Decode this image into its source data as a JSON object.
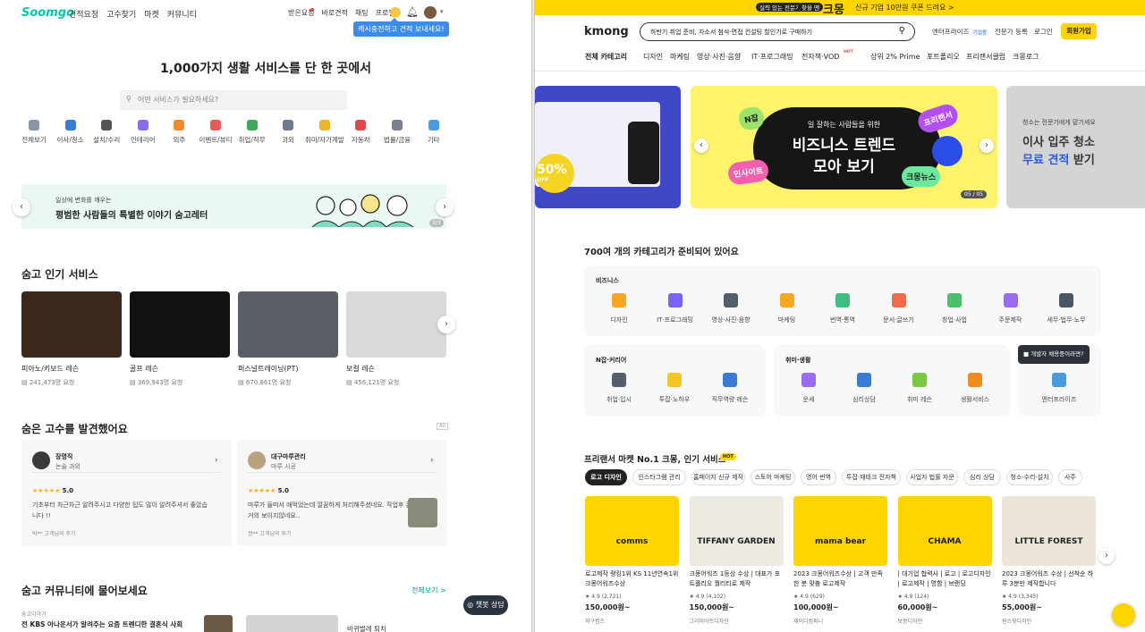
{
  "left": {
    "logo": "Soomgo",
    "nav": [
      "견적요청",
      "고수찾기",
      "마켓",
      "커뮤니티"
    ],
    "right_nav": [
      "받은요청",
      "바로견적",
      "채팅",
      "프로필"
    ],
    "tooltip": "캐시충전하고 견적 보내세요!",
    "hero": "1,000가지 생활 서비스를 단 한 곳에서",
    "search_placeholder": "어떤 서비스가 필요하세요?",
    "categories": [
      {
        "label": "전체보기",
        "color": "#8a95a5"
      },
      {
        "label": "이사/청소",
        "color": "#3a7bd5"
      },
      {
        "label": "설치/수리",
        "color": "#555"
      },
      {
        "label": "인테리어",
        "color": "#8e6be8"
      },
      {
        "label": "외주",
        "color": "#f08c2e"
      },
      {
        "label": "이벤트/뷰티",
        "color": "#e85a5a"
      },
      {
        "label": "취업/직무",
        "color": "#3aaa5a"
      },
      {
        "label": "과외",
        "color": "#6b7a8c"
      },
      {
        "label": "취미/자기계발",
        "color": "#f0b429"
      },
      {
        "label": "자동차",
        "color": "#e04848"
      },
      {
        "label": "법률/금융",
        "color": "#7a8090"
      },
      {
        "label": "기타",
        "color": "#4a9be0"
      }
    ],
    "banner": {
      "small": "일상에 변화를 깨우는",
      "big": "평범한 사람들의 특별한 이야기 숨고레터",
      "page": "3/3"
    },
    "popular_title": "숨고 인기 서비스",
    "services": [
      {
        "name": "피아노/키보드 레슨",
        "count": "241,473명 요청",
        "color": "#3a2a1e"
      },
      {
        "name": "골프 레슨",
        "count": "369,943명 요청",
        "color": "#111"
      },
      {
        "name": "퍼스널트레이닝(PT)",
        "count": "670,861명 요청",
        "color": "#5a5f66"
      },
      {
        "name": "보컬 레슨",
        "count": "456,121명 요청",
        "color": "#d9d9d9"
      }
    ],
    "pros_title": "숨은 고수를 발견했어요",
    "ad": "AD",
    "pros": [
      {
        "name": "장명직",
        "sub": "논술 과외",
        "rating": "5.0",
        "review": "기초부터 차근차근 알려주시고 다양한 팁도 많이 알려주셔서 좋았습니다 !!",
        "by": "박** 고객님의 후기",
        "avatar": "#3a3a3a"
      },
      {
        "name": "대구마루관리",
        "sub": "마루 시공",
        "rating": "5.0",
        "review": "마루가 들떠서 애먹었는데 깔끔하게 처리해주셨네요. 작업후 흔적이 거의 보이지않네요..",
        "by": "권** 고객님의 후기",
        "avatar": "#b9a27c"
      }
    ],
    "community_title": "숨고 커뮤니티에 물어보세요",
    "view_all": "전체보기 >",
    "community_tag": "숨고이야기",
    "community_item": "전 KBS 아나운서가 알려주는 요즘 트렌디한 결혼식 사회",
    "community_item2": "바뀌벌레 퇴치",
    "chatbot": "챗봇 상담"
  },
  "right": {
    "topbar": {
      "a": "실력 있는 전문가",
      "b": "찾을 땐",
      "c": "크몽",
      "d": "신규 기업 10만원 쿠폰 드려요 >"
    },
    "logo": "kmong",
    "search_value": "하반기 취업 준비, 자소서 첨삭·면접 컨설팅 할인기로 구매하기",
    "top_links": [
      "엔터프라이즈",
      "전문가 등록",
      "로그인"
    ],
    "enterprise_badge": "기업용",
    "join": "회원가입",
    "menu": [
      "전체 카테고리",
      "디자인",
      "마케팅",
      "영상·사진·음향",
      "IT·프로그래밍",
      "전자책·VOD",
      "상위 2% Prime",
      "포트폴리오",
      "프리랜서클럽",
      "크몽로그"
    ],
    "hot": "HOT",
    "slides": {
      "left_badge": "50%",
      "left_off": "OFF",
      "center": {
        "line1": "일 잘하는 사람들을 위한",
        "line2": "비즈니스 트렌드",
        "line3": "모아 보기",
        "tags": [
          "N잡",
          "프리랜서",
          "인사이트",
          "크몽뉴스"
        ],
        "page": "05 / 05"
      },
      "right": {
        "line1": "청소는 전문가에게 맡기세요",
        "line2": "이사 입주 청소",
        "line3a": "무료 견적",
        "line3b": "받기"
      }
    },
    "cat_title": "700여 개의 카테고리가 준비되어 있어요",
    "business_title": "비즈니스",
    "business": [
      {
        "label": "디자인",
        "color": "#f5a623"
      },
      {
        "label": "IT·프로그래밍",
        "color": "#7b61ff"
      },
      {
        "label": "영상·사진·음향",
        "color": "#555e6b"
      },
      {
        "label": "마케팅",
        "color": "#f5a623"
      },
      {
        "label": "번역·통역",
        "color": "#3fbf7f"
      },
      {
        "label": "문서·글쓰기",
        "color": "#f06b4a"
      },
      {
        "label": "창업·사업",
        "color": "#4cbf6b"
      },
      {
        "label": "주문제작",
        "color": "#9b6bf0"
      },
      {
        "label": "세무·법무·노무",
        "color": "#4a5566"
      }
    ],
    "njob_title": "N잡·커리어",
    "njob": [
      {
        "label": "취업·입시",
        "color": "#555e6b"
      },
      {
        "label": "투잡·노하우",
        "color": "#f5c623"
      },
      {
        "label": "직무역량 레슨",
        "color": "#3a7bd5"
      }
    ],
    "life_title": "취미·생활",
    "life": [
      {
        "label": "운세",
        "color": "#9b6bf0"
      },
      {
        "label": "심리상담",
        "color": "#3a7bd5"
      },
      {
        "label": "취미 레슨",
        "color": "#7ac943"
      },
      {
        "label": "생활서비스",
        "color": "#f58a23"
      }
    ],
    "enterprise": {
      "label": "엔터프라이즈",
      "bubble": "개발자 채용중이라면?"
    },
    "popular_title": "프리랜서 마켓 No.1 크몽, 인기 서비스",
    "chips": [
      "로고 디자인",
      "인스타그램 관리",
      "홈페이지 신규 제작",
      "스토어 마케팅",
      "영어 번역",
      "투잡·재테크 전자책",
      "사업자 법률 자문",
      "심리 상담",
      "청소·수리·설치",
      "사주"
    ],
    "products": [
      {
        "title": "로고제작 랭킹1위 KS 11년연속1위 크몽어워즈수상",
        "rating": "★ 4.9 (2,721)",
        "price": "150,000원~",
        "seller": "지구컴즈",
        "bg": "#ffd400",
        "label": "comms"
      },
      {
        "title": "크몽어워즈 1등상 수상 | 대표가 포트폴리오 퀄리티로 제작",
        "rating": "★ 4.9 (4,102)",
        "price": "150,000원~",
        "seller": "그리미아트디자인",
        "bg": "#ece9e1",
        "label": "TIFFANY GARDEN"
      },
      {
        "title": "2023 크몽어워즈수상 | 고객 만족한 분 맞춤 로고제작",
        "rating": "★ 4.9 (629)",
        "price": "100,000원~",
        "seller": "제이디컴퍼니",
        "bg": "#ffd400",
        "label": "mama bear"
      },
      {
        "title": "| 대기업 협력사 | 로고 | 로고디자인 | 로고제작 | 명함 | 브랜딩",
        "rating": "★ 4.9 (124)",
        "price": "60,000원~",
        "seller": "보몽디자인",
        "bg": "#ffd400",
        "label": "CHAMA"
      },
      {
        "title": "2023 크몽어워즈 수상 | 선착순 하루 3분만 제작합니다",
        "rating": "★ 4.9 (3,345)",
        "price": "55,000원~",
        "seller": "원스윗디자인",
        "bg": "#ece6d9",
        "label": "LITTLE FOREST"
      }
    ]
  }
}
